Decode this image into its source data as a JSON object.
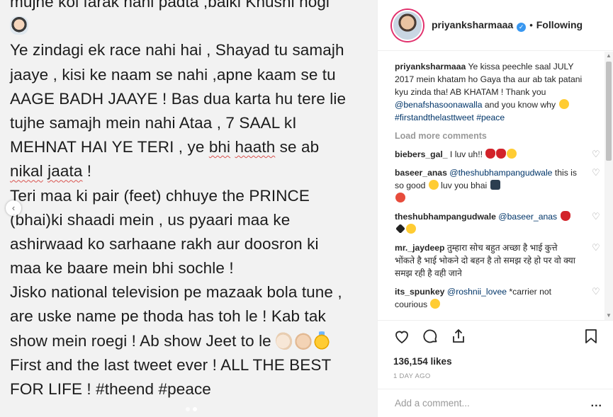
{
  "post_image": {
    "lines": [
      "mujhe koi farak nahi padta ,balki Khushi hogi",
      "",
      "Ye zindagi ek race nahi hai , Shayad tu samajh",
      "jaaye , kisi ke naam se nahi ,apne kaam se tu",
      "AAGE BADH JAAYE !  Bas dua karta hu tere lie",
      "tujhe samajh mein nahi Ataa , 7 SAAL kI",
      "MEHNAT HAI YE TERI , ye ",
      "",
      "Teri maa ki pair (feet) chhuye the PRINCE",
      "(bhai)ki shaadi mein , us pyaari maa ke",
      "ashirwaad ko sarhaane rakh aur doosron ki",
      "maa ke baare mein bhi sochle !",
      "Jisko national television pe mazaak bola tune ,",
      "are uske name pe thoda has toh le ! Kab tak",
      "show mein roegi ! Ab show Jeet to le ",
      "First and the last tweet ever ! ALL THE BEST",
      "FOR LIFE !  #theend #peace"
    ],
    "underlined": {
      "bhi": "bhi",
      "haath": "haath",
      "after_haath": " se ab",
      "nikal": "nikal",
      "jaata": "jaata",
      "after_jaata": " !"
    },
    "emojis": [
      "man-tipping-hand",
      "clapping-hands",
      "folded-hands",
      "smiling-face-with-halo"
    ]
  },
  "header": {
    "username": "priyanksharmaaa",
    "verified_icon": "verified-badge-icon",
    "separator": "•",
    "follow_state": "Following"
  },
  "caption": {
    "username": "priyanksharmaaa",
    "text_1": " Ye kissa peechle saal JULY 2017 mein khatam ho Gaya tha aur ab tak patani kyu zinda tha! AB KHATAM ! Thank you ",
    "mention": "@benafshasoonawalla",
    "text_2": " and you know why ",
    "hashtag_1": "#firstandthelasttweet",
    "hashtag_2": "#peace"
  },
  "load_more": "Load more comments",
  "comments": [
    {
      "username": "biebers_gal_",
      "text": " I luv uh!! ",
      "emojis": [
        "kiss-mark",
        "kiss-mark",
        "face-blowing-kiss"
      ]
    },
    {
      "username": "baseer_anas",
      "mention": "@theshubhampangudwale",
      "text": " this is so good ",
      "text_2": " luv you bhai ",
      "emojis": [
        "tongue",
        "smiling-face",
        "man-and-child"
      ]
    },
    {
      "username": "theshubhampangudwale",
      "mention": "@baseer_anas",
      "text": " ",
      "emojis": [
        "kiss-mark",
        "black-heart",
        "fist"
      ]
    },
    {
      "username": "mr._jaydeep",
      "text": " तुम्हारा सोच बहुत अच्छा है भाई कुत्ते भोंकते है भाई भोकने दो बहन है तो समझ रहे हो पर वो क्या समझ रही है वही जाने"
    },
    {
      "username": "its_spunkey",
      "mention": "@roshnii_lovee",
      "text": " *carrier not courious ",
      "emojis": [
        "disappointed-face"
      ]
    }
  ],
  "actions": {
    "like_icon": "heart-icon",
    "comment_icon": "comment-icon",
    "share_icon": "share-icon",
    "save_icon": "bookmark-icon"
  },
  "likes": "136,154 likes",
  "timestamp": "1 DAY AGO",
  "add_comment": {
    "placeholder": "Add a comment...",
    "more": "..."
  },
  "colors": {
    "link": "#003569",
    "muted": "#999999",
    "verified": "#3897f0",
    "squiggle": "#d9534f"
  }
}
